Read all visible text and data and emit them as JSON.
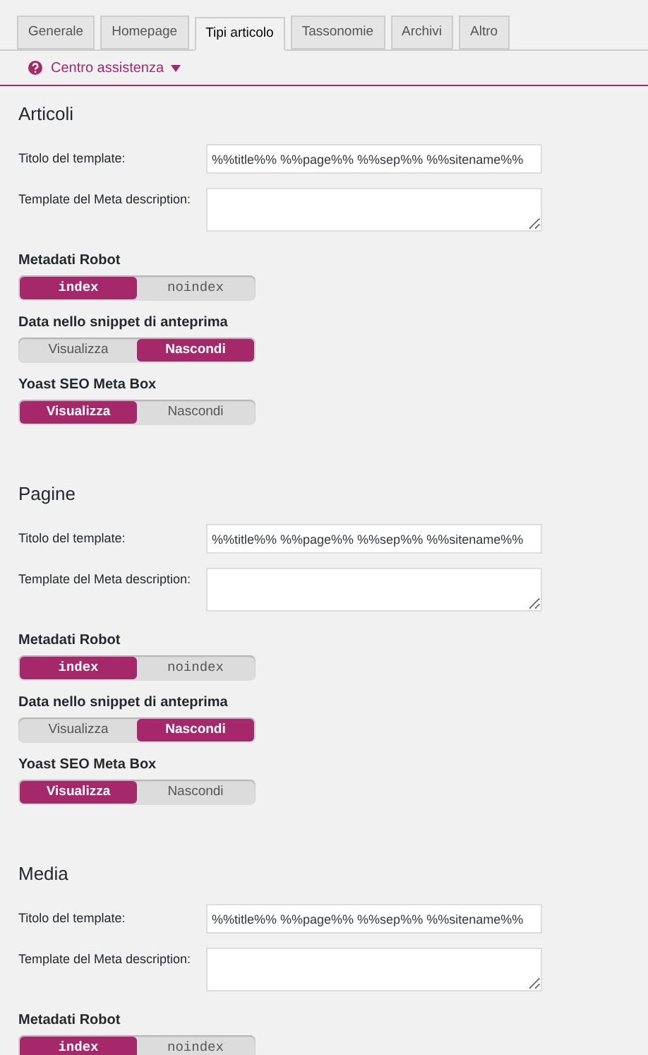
{
  "tabs": [
    {
      "label": "Generale",
      "selected": false
    },
    {
      "label": "Homepage",
      "selected": false
    },
    {
      "label": "Tipi articolo",
      "selected": true
    },
    {
      "label": "Tassonomie",
      "selected": false
    },
    {
      "label": "Archivi",
      "selected": false
    },
    {
      "label": "Altro",
      "selected": false
    }
  ],
  "help": {
    "label": "Centro assistenza",
    "expanded": false
  },
  "sections": [
    {
      "title": "Articoli",
      "template_label": "Titolo del template:",
      "template_value": "%%title%% %%page%% %%sep%% %%sitename%%",
      "meta_label": "Template del Meta description:",
      "toggles": [
        {
          "label": "Metadati Robot",
          "kind": "code",
          "options": [
            {
              "label": "index",
              "selected": true
            },
            {
              "label": "noindex",
              "selected": false
            }
          ]
        },
        {
          "label": "Data nello snippet di anteprima",
          "kind": "text",
          "options": [
            {
              "label": "Visualizza",
              "selected": false
            },
            {
              "label": "Nascondi",
              "selected": true
            }
          ]
        },
        {
          "label": "Yoast SEO Meta Box",
          "kind": "text",
          "options": [
            {
              "label": "Visualizza",
              "selected": true
            },
            {
              "label": "Nascondi",
              "selected": false
            }
          ]
        }
      ]
    },
    {
      "title": "Pagine",
      "template_label": "Titolo del template:",
      "template_value": "%%title%% %%page%% %%sep%% %%sitename%%",
      "meta_label": "Template del Meta description:",
      "toggles": [
        {
          "label": "Metadati Robot",
          "kind": "code",
          "options": [
            {
              "label": "index",
              "selected": true
            },
            {
              "label": "noindex",
              "selected": false
            }
          ]
        },
        {
          "label": "Data nello snippet di anteprima",
          "kind": "text",
          "options": [
            {
              "label": "Visualizza",
              "selected": false
            },
            {
              "label": "Nascondi",
              "selected": true
            }
          ]
        },
        {
          "label": "Yoast SEO Meta Box",
          "kind": "text",
          "options": [
            {
              "label": "Visualizza",
              "selected": true
            },
            {
              "label": "Nascondi",
              "selected": false
            }
          ]
        }
      ]
    },
    {
      "title": "Media",
      "template_label": "Titolo del template:",
      "template_value": "%%title%% %%page%% %%sep%% %%sitename%%",
      "meta_label": "Template del Meta description:",
      "toggles": [
        {
          "label": "Metadati Robot",
          "kind": "code",
          "options": [
            {
              "label": "index",
              "selected": true
            },
            {
              "label": "noindex",
              "selected": false
            }
          ]
        }
      ]
    }
  ]
}
